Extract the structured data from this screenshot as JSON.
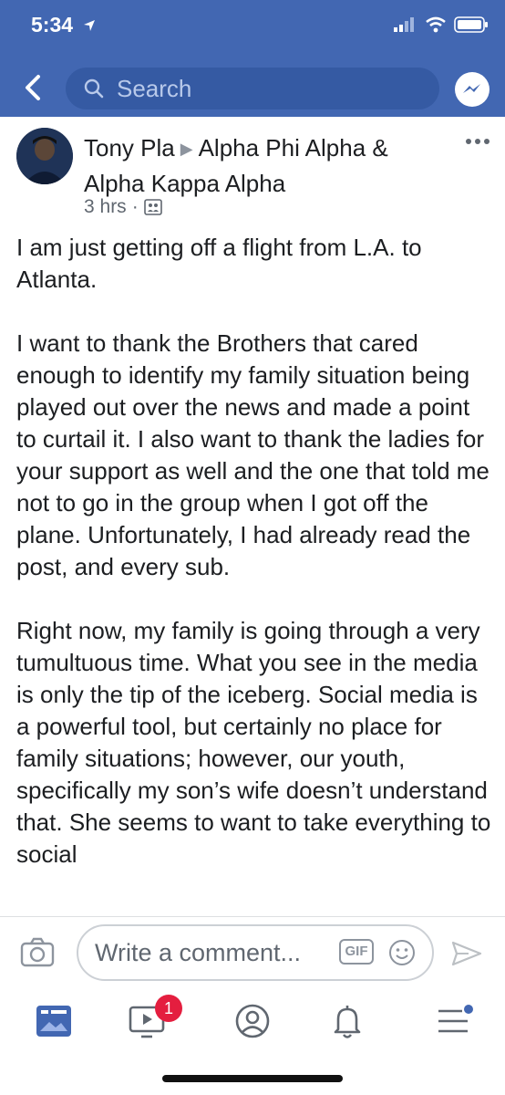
{
  "status_bar": {
    "time": "5:34"
  },
  "header": {
    "search_placeholder": "Search"
  },
  "post": {
    "author": "Tony Pla",
    "group_line1": "Alpha Phi Alpha &",
    "group_line2": "Alpha Kappa Alpha",
    "time_ago": "3 hrs",
    "separator": "·",
    "paragraphs": [
      "I am just getting off a flight from L.A. to Atlanta.",
      "I want to thank the Brothers that cared enough to identify my family situation being played out over the news and made a point to curtail it. I also want to thank the ladies for your support as well and the one that told me not to go in the group when I got off the plane. Unfortunately, I had already read the post, and every sub.",
      "Right now, my family is going through a very tumultuous time.  What you see in the media is only the tip of the iceberg. Social media is a powerful tool, but certainly no place for family situations; however, our youth, specifically my son’s wife doesn’t understand that. She seems to want to take everything to social"
    ]
  },
  "comment_bar": {
    "placeholder": "Write a comment...",
    "gif_label": "GIF"
  },
  "tabbar": {
    "video_badge": "1",
    "items": [
      "news-feed",
      "watch",
      "profile",
      "notifications",
      "menu"
    ]
  },
  "colors": {
    "brand_blue": "#4267b2",
    "search_bg": "#355aa3",
    "badge_red": "#e41e3f"
  }
}
